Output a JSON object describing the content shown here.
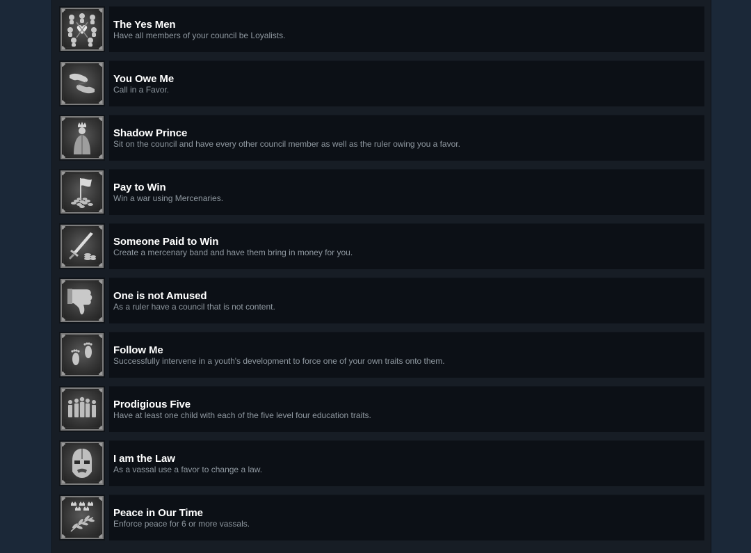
{
  "achievements": [
    {
      "title": "The Yes Men",
      "description": "Have all members of your council be Loyalists.",
      "icon": "council-faces-icon"
    },
    {
      "title": "You Owe Me",
      "description": "Call in a Favor.",
      "icon": "handshake-icon"
    },
    {
      "title": "Shadow Prince",
      "description": "Sit on the council and have every other council member as well as the ruler owing you a favor.",
      "icon": "crowned-figure-icon"
    },
    {
      "title": "Pay to Win",
      "description": "Win a war using Mercenaries.",
      "icon": "flag-coins-icon"
    },
    {
      "title": "Someone Paid to Win",
      "description": "Create a mercenary band and have them bring in money for you.",
      "icon": "sword-coins-icon"
    },
    {
      "title": "One is not Amused",
      "description": "As a ruler have a council that is not content.",
      "icon": "thumbs-down-icon"
    },
    {
      "title": "Follow Me",
      "description": "Successfully intervene in a youth's development to force one of your own traits onto them.",
      "icon": "footprints-icon"
    },
    {
      "title": "Prodigious Five",
      "description": "Have at least one child with each of the five level four education traits.",
      "icon": "five-figures-icon"
    },
    {
      "title": "I am the Law",
      "description": "As a vassal use a favor to change a law.",
      "icon": "helmet-mask-icon"
    },
    {
      "title": "Peace in Our Time",
      "description": "Enforce peace for 6 or more vassals.",
      "icon": "olive-branch-crowns-icon"
    }
  ],
  "colors": {
    "page_background": "#1b2838",
    "panel_background": "#171d25",
    "row_background": "#0c1016",
    "title_color": "#ffffff",
    "description_color": "#8f98a0"
  }
}
